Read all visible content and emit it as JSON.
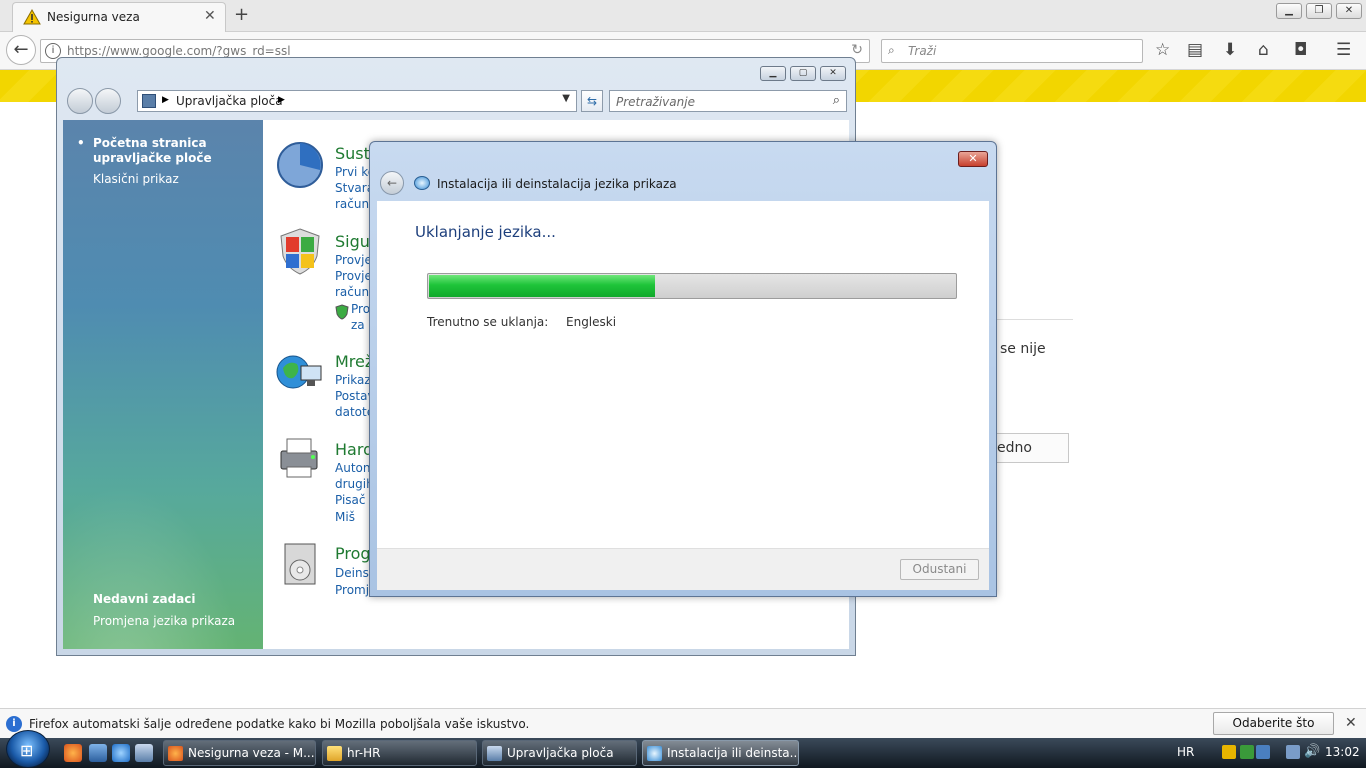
{
  "browser": {
    "tab_title": "Nesigurna veza",
    "url": "https://www.google.com/?gws_rd=ssl",
    "search_placeholder": "Traži",
    "new_tab": "+",
    "page_partial_text": "se nije",
    "page_partial_button": "edno"
  },
  "control_panel": {
    "address": "Upravljačka ploča",
    "search_placeholder": "Pretraživanje",
    "sidebar": {
      "home": "Početna stranica upravljačke ploče",
      "classic": "Klasični prikaz",
      "recent_heading": "Nedavni zadaci",
      "recent_item": "Promjena jezika prikaza"
    },
    "categories": [
      {
        "title": "Susta",
        "links": [
          "Prvi ko",
          "Stvara",
          "računa"
        ]
      },
      {
        "title": "Sigu",
        "links": [
          "Provje",
          "Provje",
          "računa",
          "Pro",
          "za W"
        ]
      },
      {
        "title": "Mrež",
        "links": [
          "Prikaz",
          "Postav",
          "datote"
        ]
      },
      {
        "title": "Hard",
        "links": [
          "Auton",
          "drugih",
          "Pisač",
          "Miš"
        ]
      },
      {
        "title": "Prog",
        "links": [
          "Deinst",
          "Promj"
        ]
      }
    ]
  },
  "dialog": {
    "title": "Instalacija ili deinstalacija jezika prikaza",
    "heading": "Uklanjanje jezika...",
    "progress_fraction": 0.43,
    "current_label": "Trenutno se uklanja:",
    "current_value": "Engleski",
    "cancel": "Odustani"
  },
  "notification": {
    "message": "Firefox automatski šalje određene podatke kako bi Mozilla poboljšala vaše iskustvo.",
    "button": "Odaberite što dijelite"
  },
  "taskbar": {
    "items": [
      {
        "label": "Nesigurna veza - M..."
      },
      {
        "label": "hr-HR"
      },
      {
        "label": "Upravljačka ploča"
      },
      {
        "label": "Instalacija ili deinsta..."
      }
    ],
    "language": "HR",
    "clock": "13:02"
  }
}
